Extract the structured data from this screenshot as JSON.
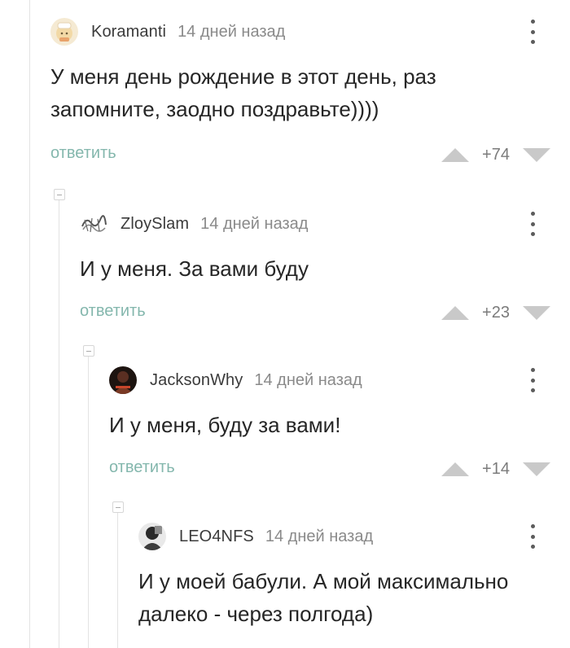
{
  "comments": [
    {
      "username": "Koramanti",
      "time": "14 дней назад",
      "text": "У меня день рождение в этот день, раз\nзапомните, заодно поздравьте))))",
      "reply_label": "ответить",
      "score": "+74",
      "avatar_icon": "cartoon-avatar-icon"
    },
    {
      "username": "ZloySlam",
      "time": "14 дней назад",
      "text": "И у меня. За вами буду",
      "reply_label": "ответить",
      "score": "+23",
      "avatar_icon": "graffiti-avatar-icon"
    },
    {
      "username": "JacksonWhy",
      "time": "14 дней назад",
      "text": "И у меня, буду за вами!",
      "reply_label": "ответить",
      "score": "+14",
      "avatar_icon": "dark-photo-avatar-icon"
    },
    {
      "username": "LEO4NFS",
      "time": "14 дней назад",
      "text": "И у моей бабули. А мой максимально\nдалеко - через полгода)",
      "avatar_icon": "bw-photo-avatar-icon"
    }
  ]
}
